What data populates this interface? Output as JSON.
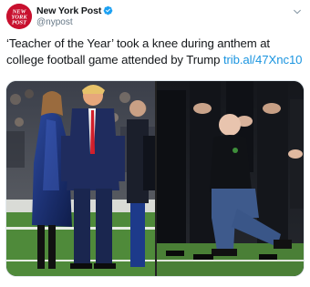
{
  "account": {
    "display_name": "New York Post",
    "handle": "@nypost",
    "avatar_text": "NEW YORK POST",
    "verified": true,
    "avatar_color": "#c8102e"
  },
  "tweet": {
    "text_line1": "‘Teacher of the Year’ took a knee during anthem at",
    "text_line2": "college football game attended by Trump",
    "link_text": "trib.al/47Xnc10",
    "link_color": "#1b95e0"
  },
  "media": {
    "images": [
      {
        "name": "photo-trump-melania"
      },
      {
        "name": "photo-teacher-kneeling"
      }
    ]
  },
  "icons": {
    "verified": "verified-badge-icon",
    "menu": "chevron-down-icon"
  }
}
